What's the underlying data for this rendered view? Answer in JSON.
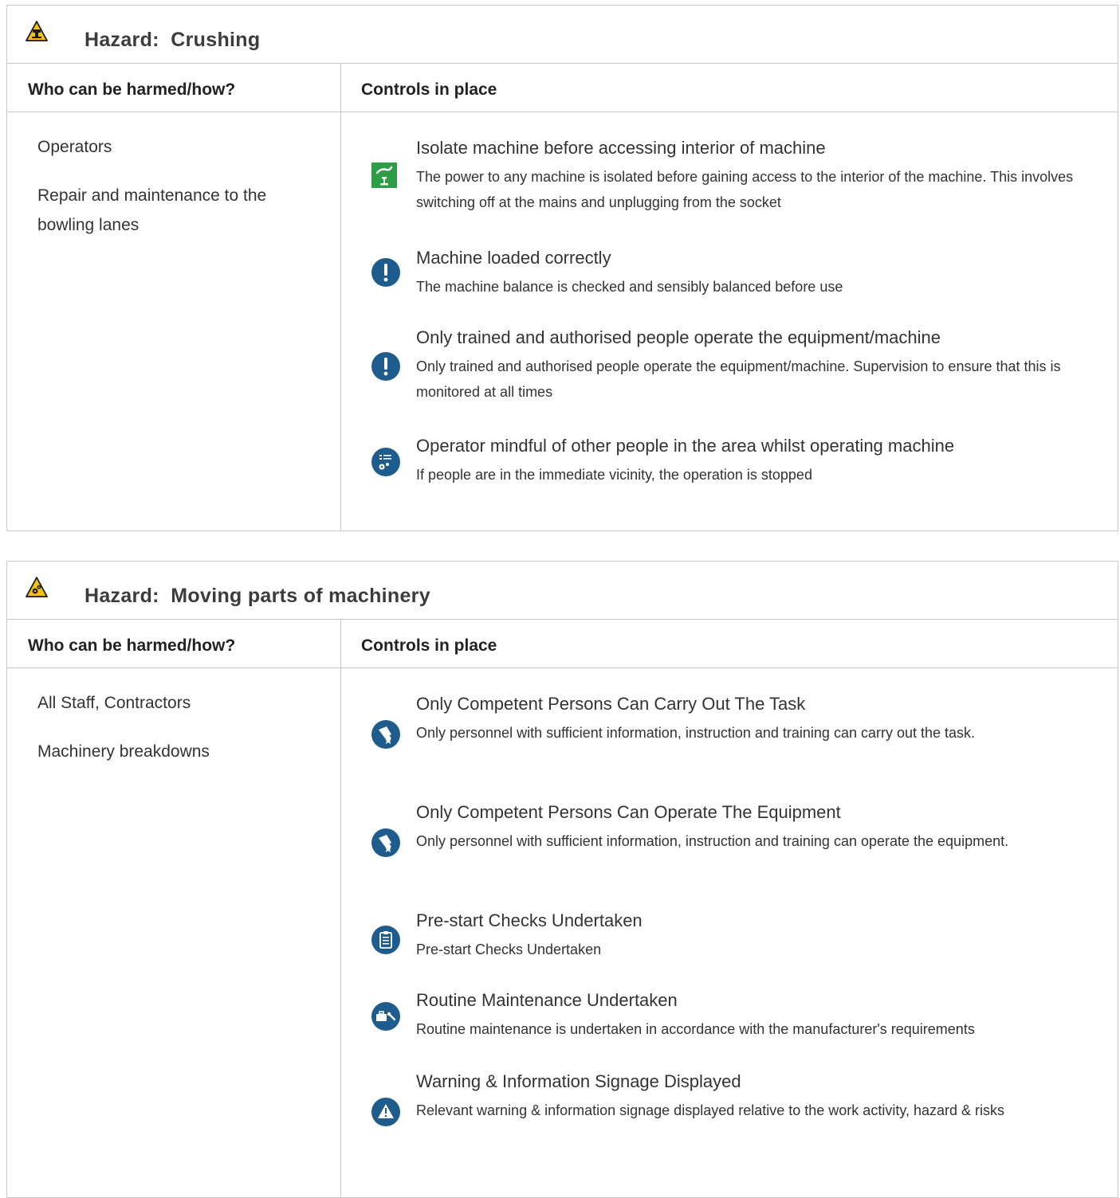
{
  "colors": {
    "border": "#c8c8c8",
    "hazard_yellow": "#f4c20d",
    "icon_blue": "#1e5c8e",
    "icon_green": "#2e9e46"
  },
  "hazards": [
    {
      "icon": "crushing-hazard-icon",
      "label": "Hazard:",
      "name": "Crushing",
      "col_who": "Who can be harmed/how?",
      "col_controls": "Controls in place",
      "who": [
        "Operators",
        "Repair and maintenance to the bowling lanes"
      ],
      "controls": [
        {
          "icon": "isolate-power-icon",
          "title": "Isolate machine before accessing interior of machine",
          "desc": "The power to any machine is isolated before gaining access to the interior of the machine. This involves switching off at the mains and unplugging from the socket"
        },
        {
          "icon": "exclamation-icon",
          "title": "Machine loaded correctly",
          "desc": "The machine balance is checked and sensibly balanced before use"
        },
        {
          "icon": "exclamation-icon",
          "title": "Only trained and authorised people operate the equipment/machine",
          "desc": "Only trained and authorised people operate the equipment/machine. Supervision to ensure that this is monitored at all times"
        },
        {
          "icon": "procedure-gear-icon",
          "title": "Operator mindful of other people in the area whilst operating machine",
          "desc": "If people are in the immediate vicinity, the operation is stopped"
        }
      ]
    },
    {
      "icon": "moving-parts-hazard-icon",
      "label": "Hazard:",
      "name": "Moving parts of machinery",
      "col_who": "Who can be harmed/how?",
      "col_controls": "Controls in place",
      "who": [
        "All Staff, Contractors",
        "Machinery breakdowns"
      ],
      "controls": [
        {
          "icon": "certificate-icon",
          "title": "Only Competent Persons Can Carry Out The Task",
          "desc": "Only personnel with sufficient information, instruction and training can carry out the task."
        },
        {
          "icon": "certificate-icon",
          "title": "Only Competent Persons Can Operate The Equipment",
          "desc": "Only personnel with sufficient information, instruction and training can operate the equipment."
        },
        {
          "icon": "clipboard-icon",
          "title": "Pre-start Checks Undertaken",
          "desc": "Pre-start Checks Undertaken"
        },
        {
          "icon": "toolbox-wrench-icon",
          "title": "Routine Maintenance Undertaken",
          "desc": "Routine maintenance is undertaken in accordance with the manufacturer's requirements"
        },
        {
          "icon": "warning-triangle-icon",
          "title": "Warning & Information Signage Displayed",
          "desc": "Relevant warning & information signage displayed relative to the work activity, hazard & risks"
        }
      ]
    }
  ]
}
